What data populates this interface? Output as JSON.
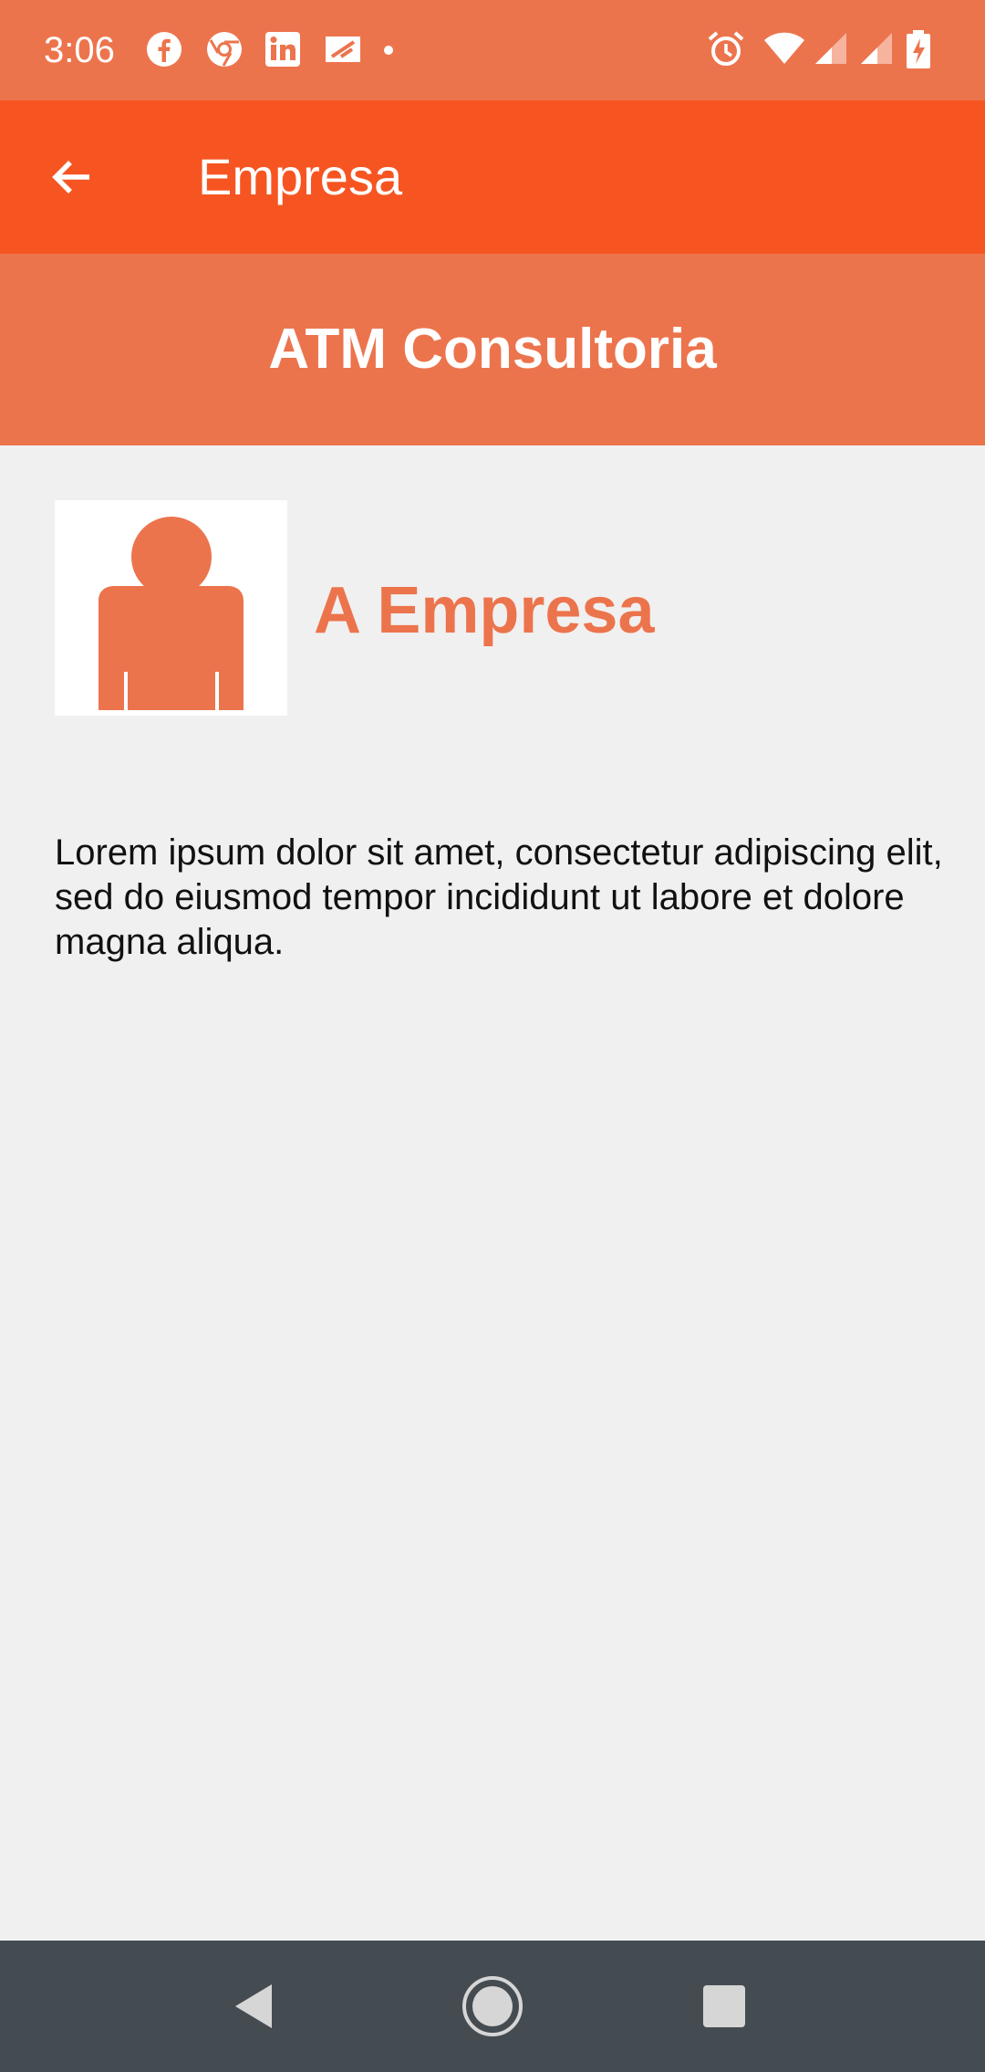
{
  "status_bar": {
    "time": "3:06",
    "left_icons": [
      "facebook-icon",
      "chrome-icon",
      "linkedin-icon",
      "payment-card-icon",
      "notification-dot-icon"
    ],
    "right_icons": [
      "alarm-icon",
      "wifi-icon",
      "signal-icon",
      "signal-icon",
      "battery-charging-icon"
    ],
    "background": "#ec744d"
  },
  "app_bar": {
    "title": "Empresa",
    "back_icon": "arrow-left-icon",
    "background": "#f65522"
  },
  "header": {
    "company_name": "ATM Consultoria",
    "background": "#ec744d"
  },
  "content": {
    "avatar_icon": "person-icon",
    "section_title": "A Empresa",
    "description": "Lorem ipsum dolor sit amet, consectetur adipiscing elit, sed do eiusmod tempor incididunt ut labore et dolore magna aliqua.",
    "accent": "#ec744d"
  },
  "nav_bar": {
    "buttons": [
      "back-triangle-icon",
      "home-circle-icon",
      "recents-square-icon"
    ],
    "background": "#454c51"
  }
}
